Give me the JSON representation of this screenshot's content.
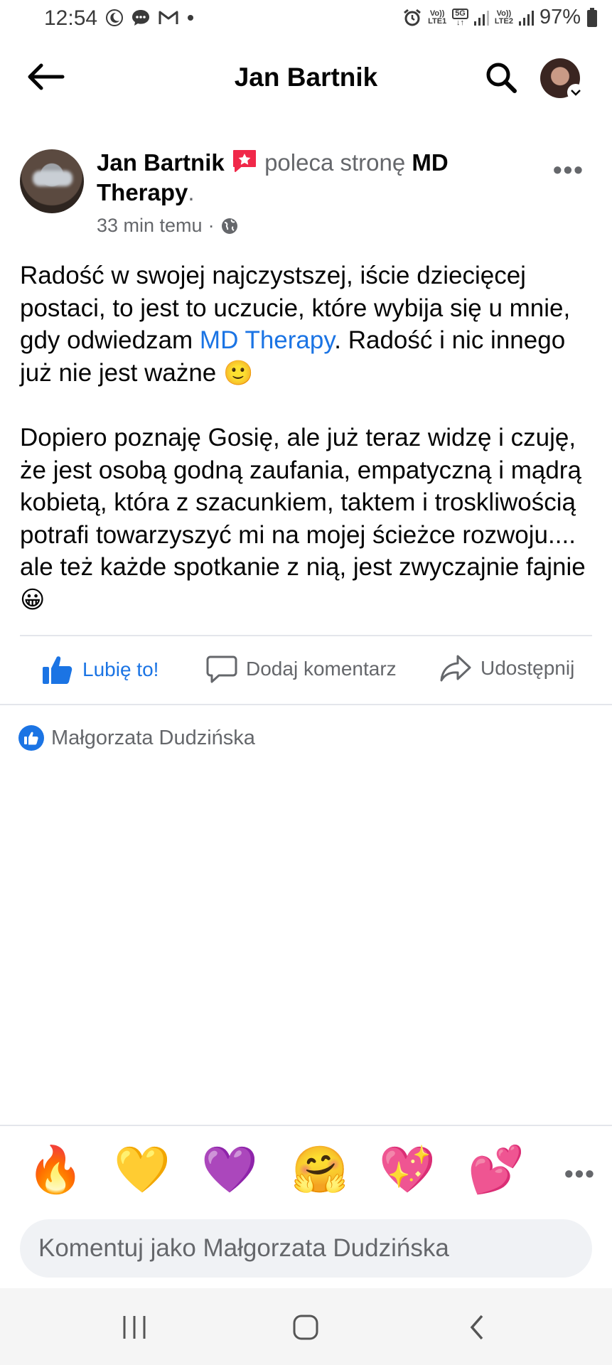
{
  "status_bar": {
    "time": "12:54",
    "net1_top": "Vo))",
    "net1_bottom": "LTE1",
    "net_5g": "5G",
    "net2_top": "Vo))",
    "net2_bottom": "LTE2",
    "battery": "97%"
  },
  "header": {
    "title": "Jan Bartnik"
  },
  "post": {
    "author": "Jan Bartnik",
    "verb": "poleca stronę",
    "page": "MD Therapy",
    "period": ".",
    "time": "33 min temu",
    "separator": "·",
    "paragraph1_a": "Radość w swojej najczystszej, iście dziecięcej postaci, to jest to uczucie, które wybija się u mnie, gdy odwiedzam ",
    "paragraph1_link": "MD Therapy",
    "paragraph1_b": ". Radość i nic innego już nie jest ważne ",
    "paragraph1_emoji": "🙂",
    "paragraph2": "Dopiero poznaję Gosię, ale już teraz widzę i czuję, że jest osobą godną zaufania, empatyczną i mądrą kobietą, która z szacunkiem, taktem i troskliwością potrafi towarzyszyć mi na mojej ścieżce rozwoju.... ale też każde spotkanie z nią, jest zwyczajnie fajnie ",
    "paragraph2_emoji": "😀"
  },
  "actions": {
    "like": "Lubię to!",
    "comment": "Dodaj komentarz",
    "share": "Udostępnij"
  },
  "likes": {
    "name": "Małgorzata Dudzińska"
  },
  "emoji_bar": [
    "🔥",
    "💛",
    "💜",
    "🤗",
    "💖",
    "💕"
  ],
  "comment_input": {
    "placeholder": "Komentuj jako Małgorzata Dudzińska"
  },
  "colors": {
    "accent": "#1b74e4",
    "secondary_text": "#65676b"
  }
}
